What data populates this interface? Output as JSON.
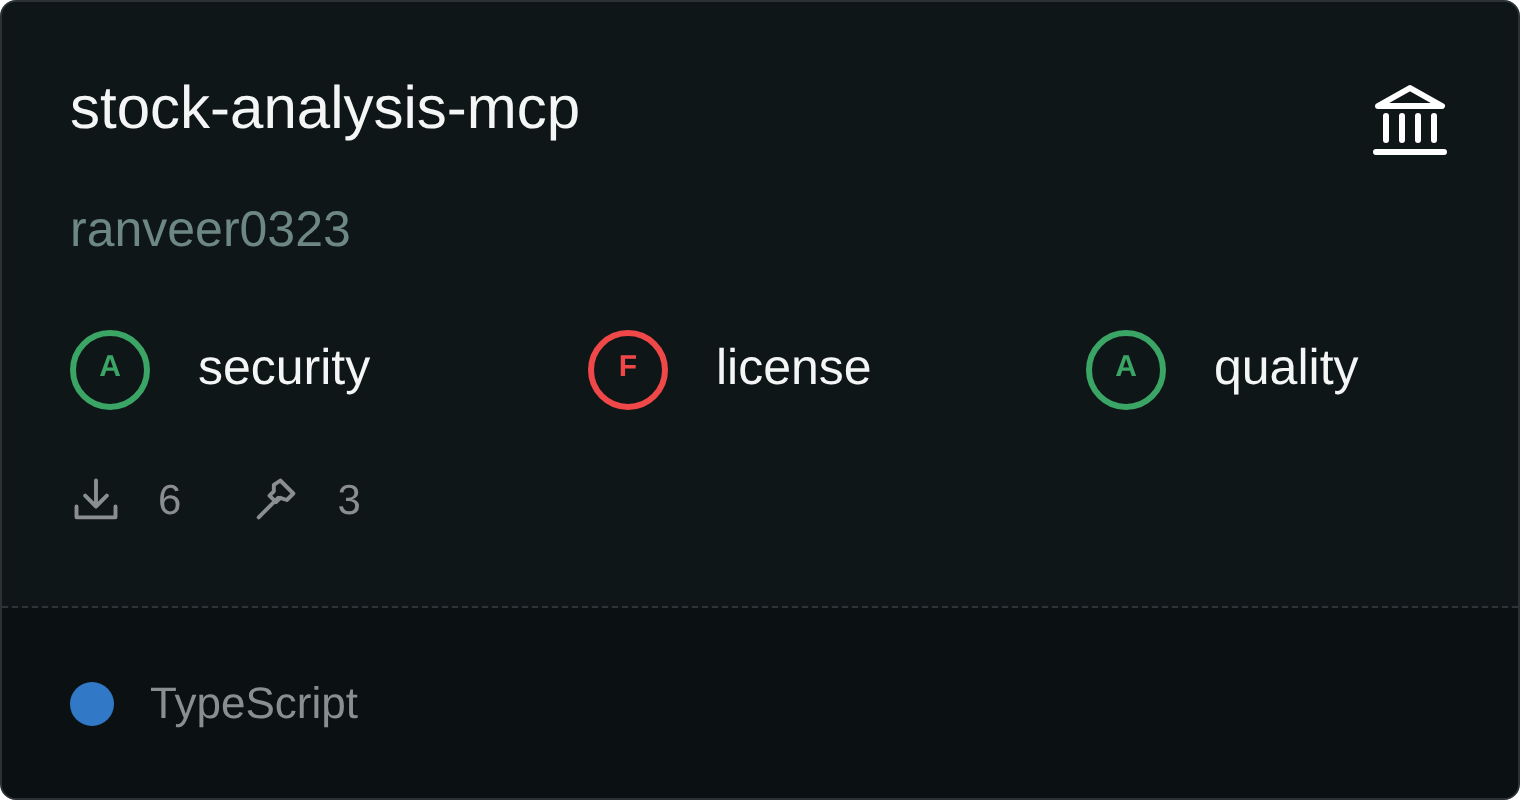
{
  "title": "stock-analysis-mcp",
  "author": "ranveer0323",
  "grades": [
    {
      "grade": "A",
      "label": "security",
      "color": "#3ba565"
    },
    {
      "grade": "F",
      "label": "license",
      "color": "#f04848"
    },
    {
      "grade": "A",
      "label": "quality",
      "color": "#3ba565"
    }
  ],
  "stats": [
    {
      "kind": "downloads",
      "value": "6"
    },
    {
      "kind": "tools",
      "value": "3"
    }
  ],
  "language": {
    "name": "TypeScript",
    "color": "#3178c6"
  }
}
